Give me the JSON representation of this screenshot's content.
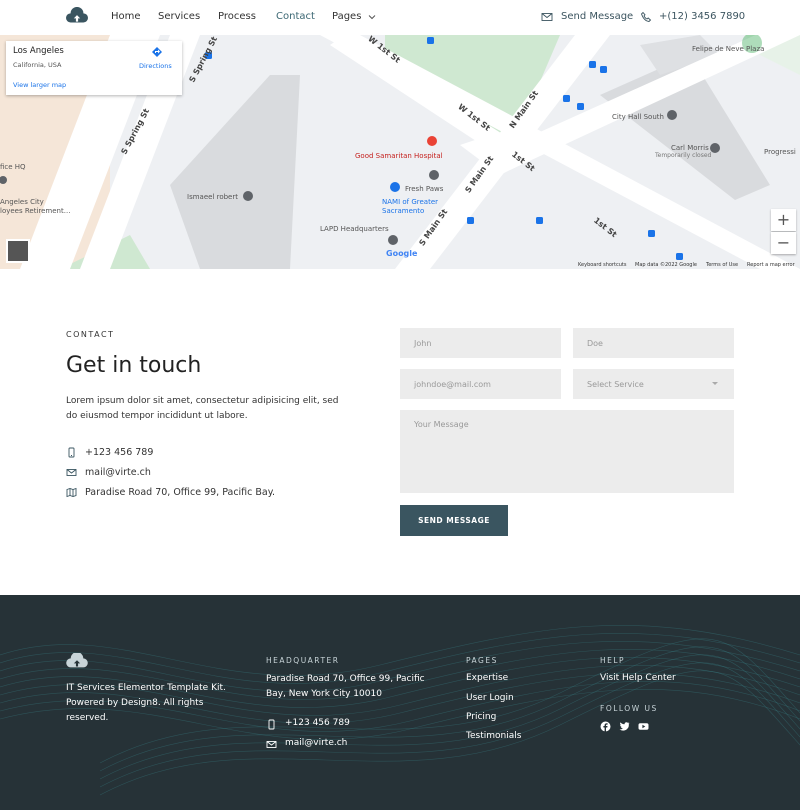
{
  "nav": {
    "items": [
      "Home",
      "Services",
      "Process",
      "Contact",
      "Pages"
    ],
    "active": "Contact",
    "send_message": "Send Message",
    "phone": "+(12) 3456 7890"
  },
  "map": {
    "place_title": "Los Angeles",
    "place_subtitle": "California, USA",
    "view_larger": "View larger map",
    "directions": "Directions",
    "labels": {
      "hospital": "Good Samaritan Hospital",
      "fresh_paws": "Fresh Paws",
      "nami": "NAMI of Greater Sacramento",
      "lapd": "LAPD Headquarters",
      "ismaeel": "Ismaeel robert",
      "city_hall": "City Hall South",
      "carl_morris": "Carl Morris",
      "temporarily_closed": "Temporarily closed",
      "felipe": "Felipe de Neve Plaza",
      "progress": "Progressi",
      "ice_hq": "fice HQ",
      "angeles_city": "Angeles City",
      "retirement": "loyees Retirement..."
    },
    "roads": [
      "W 1st St",
      "W 1st St",
      "N Main St",
      "1st St",
      "S Main St",
      "S Main St",
      "1st St",
      "S Spring St",
      "S Spring St"
    ],
    "zoom_in": "+",
    "zoom_out": "−",
    "google": "Google",
    "attribution": [
      "Keyboard shortcuts",
      "Map data ©2022 Google",
      "Terms of Use",
      "Report a map error"
    ]
  },
  "contact": {
    "eyebrow": "CONTACT",
    "title": "Get in touch",
    "description": "Lorem ipsum dolor sit amet, consectetur adipisicing elit, sed do eiusmod tempor incididunt ut labore.",
    "phone": "+123 456 789",
    "email": "mail@virte.ch",
    "address": "Paradise Road 70, Office 99, Pacific Bay."
  },
  "form": {
    "first_name": "John",
    "last_name": "Doe",
    "email": "johndoe@mail.com",
    "service": "Select Service",
    "message": "Your Message",
    "submit": "SEND MESSAGE"
  },
  "footer": {
    "about": "IT Services Elementor Template Kit. Powered by Design8. All rights reserved.",
    "hq_heading": "HEADQUARTER",
    "hq_address": "Paradise Road 70, Office 99, Pacific Bay,  New York City 10010",
    "phone": "+123 456 789",
    "email": "mail@virte.ch",
    "pages_heading": "PAGES",
    "pages": [
      "Expertise",
      "User Login",
      "Pricing",
      "Testimonials"
    ],
    "help_heading": "HELP",
    "help_link": "Visit Help Center",
    "follow_heading": "FOLLOW US",
    "social_icons": [
      "facebook-icon",
      "twitter-icon",
      "youtube-icon"
    ]
  },
  "colors": {
    "accent": "#3a5560",
    "footer_bg": "#263237",
    "field_bg": "#ececec",
    "map_bg": "#eef0f3"
  }
}
